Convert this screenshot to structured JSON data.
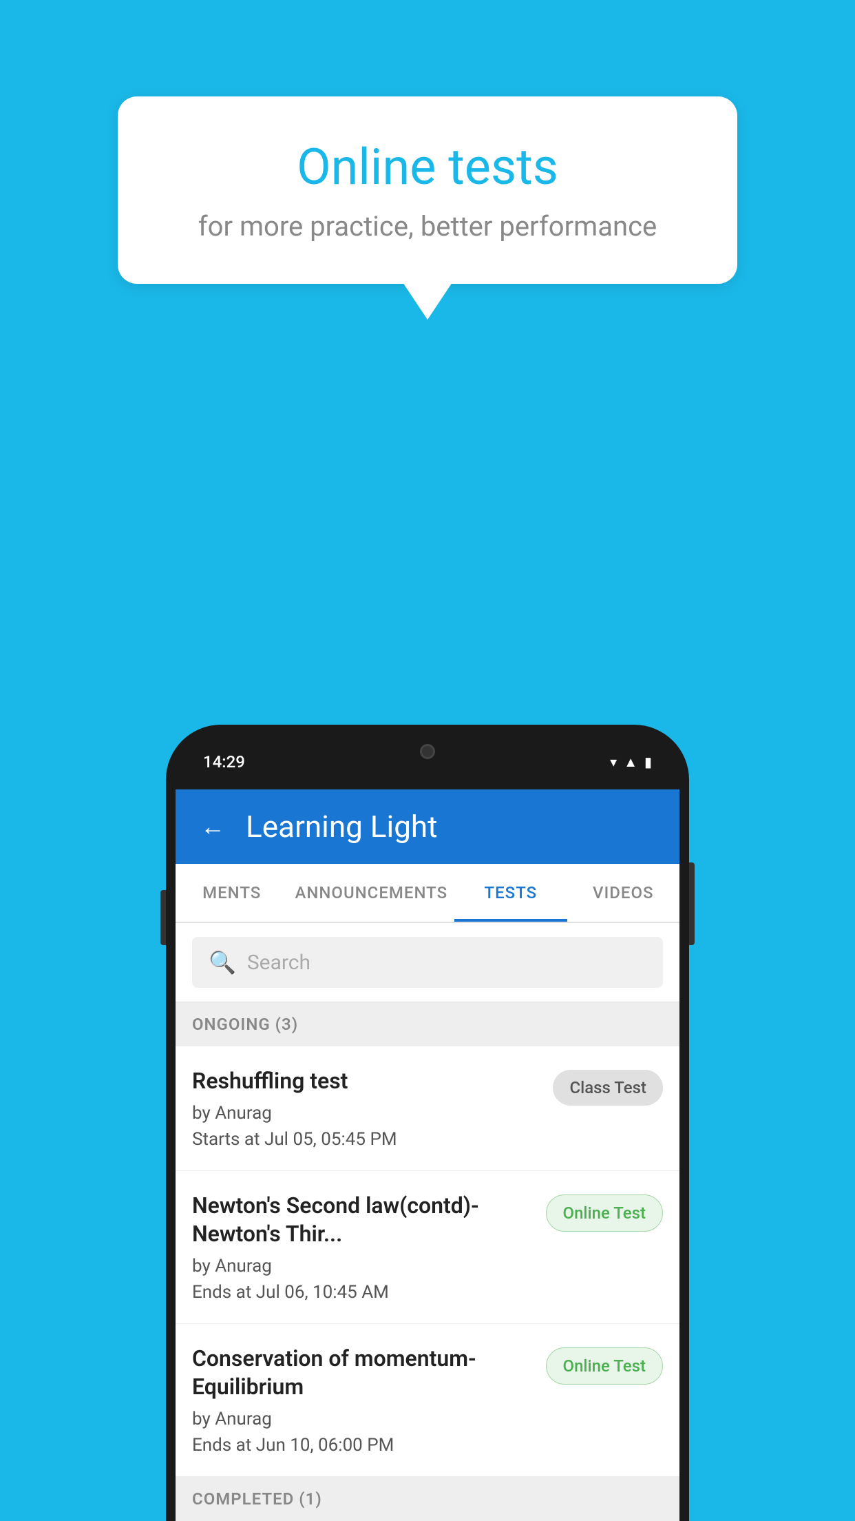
{
  "background_color": "#1ab8e8",
  "speech_bubble": {
    "title": "Online tests",
    "subtitle": "for more practice, better performance"
  },
  "phone": {
    "status_bar": {
      "time": "14:29",
      "icons": [
        "wifi",
        "signal",
        "battery"
      ]
    },
    "header": {
      "title": "Learning Light",
      "back_label": "←"
    },
    "tabs": [
      {
        "label": "MENTS",
        "active": false
      },
      {
        "label": "ANNOUNCEMENTS",
        "active": false
      },
      {
        "label": "TESTS",
        "active": true
      },
      {
        "label": "VIDEOS",
        "active": false
      }
    ],
    "search": {
      "placeholder": "Search",
      "icon": "🔍"
    },
    "sections": [
      {
        "header": "ONGOING (3)",
        "items": [
          {
            "title": "Reshuffling test",
            "author": "by Anurag",
            "date": "Starts at  Jul 05, 05:45 PM",
            "badge": "Class Test",
            "badge_type": "class"
          },
          {
            "title": "Newton's Second law(contd)-Newton's Thir...",
            "author": "by Anurag",
            "date": "Ends at  Jul 06, 10:45 AM",
            "badge": "Online Test",
            "badge_type": "online"
          },
          {
            "title": "Conservation of momentum-Equilibrium",
            "author": "by Anurag",
            "date": "Ends at  Jun 10, 06:00 PM",
            "badge": "Online Test",
            "badge_type": "online"
          }
        ]
      },
      {
        "header": "COMPLETED (1)",
        "items": []
      }
    ]
  }
}
